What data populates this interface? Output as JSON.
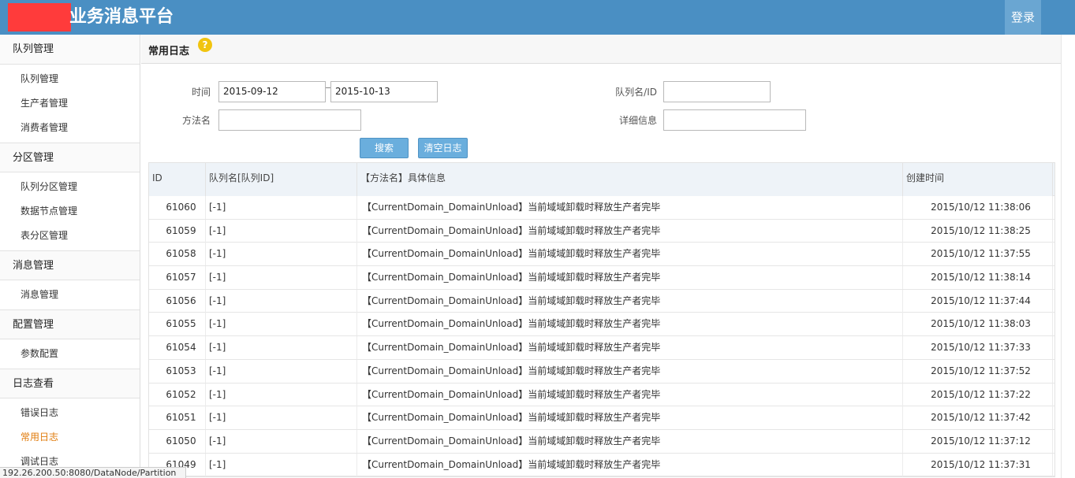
{
  "header": {
    "title": "业务消息平台",
    "login_label": "登录"
  },
  "sidebar": {
    "groups": [
      {
        "title": "队列管理",
        "items": [
          {
            "label": "队列管理"
          },
          {
            "label": "生产者管理"
          },
          {
            "label": "消费者管理"
          }
        ]
      },
      {
        "title": "分区管理",
        "items": [
          {
            "label": "队列分区管理"
          },
          {
            "label": "数据节点管理"
          },
          {
            "label": "表分区管理"
          }
        ]
      },
      {
        "title": "消息管理",
        "items": [
          {
            "label": "消息管理"
          }
        ]
      },
      {
        "title": "配置管理",
        "items": [
          {
            "label": "参数配置"
          }
        ]
      },
      {
        "title": "日志查看",
        "items": [
          {
            "label": "错误日志"
          },
          {
            "label": "常用日志"
          },
          {
            "label": "调试日志"
          }
        ]
      }
    ],
    "active_item": "常用日志"
  },
  "page": {
    "title": "常用日志",
    "help_icon": "question-icon"
  },
  "filters": {
    "time_label": "时间",
    "date_from": "2015-09-12",
    "date_to": "2015-10-13",
    "queue_label": "队列名/ID",
    "queue_value": "",
    "method_label": "方法名",
    "method_value": "",
    "detail_label": "详细信息",
    "detail_value": ""
  },
  "buttons": {
    "search": "搜索",
    "clear": "清空日志"
  },
  "table": {
    "columns": [
      "ID",
      "队列名[队列ID]",
      "【方法名】具体信息",
      "创建时间"
    ],
    "rows": [
      {
        "id": "61060",
        "queue": "[-1]",
        "msg": "【CurrentDomain_DomainUnload】当前域域卸载时释放生产者完毕",
        "time": "2015/10/12 11:38:06"
      },
      {
        "id": "61059",
        "queue": "[-1]",
        "msg": "【CurrentDomain_DomainUnload】当前域域卸载时释放生产者完毕",
        "time": "2015/10/12 11:38:25"
      },
      {
        "id": "61058",
        "queue": "[-1]",
        "msg": "【CurrentDomain_DomainUnload】当前域域卸载时释放生产者完毕",
        "time": "2015/10/12 11:37:55"
      },
      {
        "id": "61057",
        "queue": "[-1]",
        "msg": "【CurrentDomain_DomainUnload】当前域域卸载时释放生产者完毕",
        "time": "2015/10/12 11:38:14"
      },
      {
        "id": "61056",
        "queue": "[-1]",
        "msg": "【CurrentDomain_DomainUnload】当前域域卸载时释放生产者完毕",
        "time": "2015/10/12 11:37:44"
      },
      {
        "id": "61055",
        "queue": "[-1]",
        "msg": "【CurrentDomain_DomainUnload】当前域域卸载时释放生产者完毕",
        "time": "2015/10/12 11:38:03"
      },
      {
        "id": "61054",
        "queue": "[-1]",
        "msg": "【CurrentDomain_DomainUnload】当前域域卸载时释放生产者完毕",
        "time": "2015/10/12 11:37:33"
      },
      {
        "id": "61053",
        "queue": "[-1]",
        "msg": "【CurrentDomain_DomainUnload】当前域域卸载时释放生产者完毕",
        "time": "2015/10/12 11:37:52"
      },
      {
        "id": "61052",
        "queue": "[-1]",
        "msg": "【CurrentDomain_DomainUnload】当前域域卸载时释放生产者完毕",
        "time": "2015/10/12 11:37:22"
      },
      {
        "id": "61051",
        "queue": "[-1]",
        "msg": "【CurrentDomain_DomainUnload】当前域域卸载时释放生产者完毕",
        "time": "2015/10/12 11:37:42"
      },
      {
        "id": "61050",
        "queue": "[-1]",
        "msg": "【CurrentDomain_DomainUnload】当前域域卸载时释放生产者完毕",
        "time": "2015/10/12 11:37:12"
      },
      {
        "id": "61049",
        "queue": "[-1]",
        "msg": "【CurrentDomain_DomainUnload】当前域域卸载时释放生产者完毕",
        "time": "2015/10/12 11:37:31"
      }
    ]
  },
  "status_bar": {
    "text": "192.26.200.50:8080/DataNode/Partition"
  },
  "colors": {
    "header_bg": "#4a8fc3",
    "active_item": "#e07b0c",
    "button_bg": "#6aaedd",
    "redaction": "#ff3b3b"
  }
}
